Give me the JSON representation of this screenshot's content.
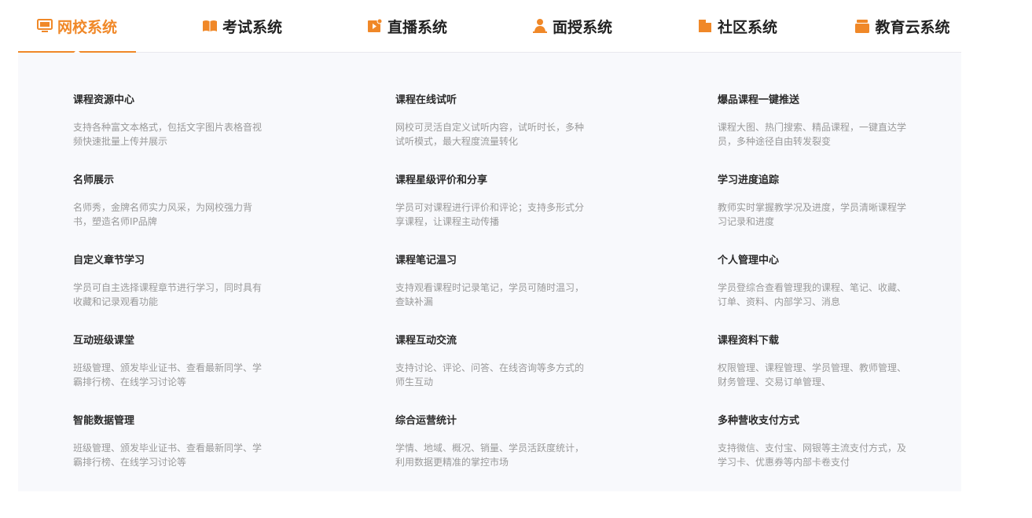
{
  "tabs": [
    {
      "label": "网校系统",
      "icon": "monitor-icon",
      "active": true
    },
    {
      "label": "考试系统",
      "icon": "book-icon",
      "active": false
    },
    {
      "label": "直播系统",
      "icon": "live-play-icon",
      "active": false
    },
    {
      "label": "面授系统",
      "icon": "teacher-icon",
      "active": false
    },
    {
      "label": "社区系统",
      "icon": "community-icon",
      "active": false
    },
    {
      "label": "教育云系统",
      "icon": "cloud-box-icon",
      "active": false
    }
  ],
  "colors": {
    "accent": "#f08828",
    "panel_bg": "#f8f9fc"
  },
  "features": [
    {
      "title": "课程资源中心",
      "desc": "支持各种富文本格式，包括文字图片表格音视频快速批量上传并展示"
    },
    {
      "title": "课程在线试听",
      "desc": "网校可灵活自定义试听内容，试听时长，多种试听模式，最大程度流量转化"
    },
    {
      "title": "爆品课程一键推送",
      "desc": "课程大图、热门搜索、精品课程，一键直达学员，多种途径自由转发裂变"
    },
    {
      "title": "名师展示",
      "desc": "名师秀，金牌名师实力风采，为网校强力背书，塑造名师IP品牌"
    },
    {
      "title": "课程星级评价和分享",
      "desc": "学员可对课程进行评价和评论；支持多形式分享课程，让课程主动传播"
    },
    {
      "title": "学习进度追踪",
      "desc": "教师实时掌握教学况及进度，学员清晰课程学习记录和进度"
    },
    {
      "title": "自定义章节学习",
      "desc": "学员可自主选择课程章节进行学习，同时具有收藏和记录观看功能"
    },
    {
      "title": "课程笔记温习",
      "desc": "支持观看课程时记录笔记，学员可随时温习，查缺补漏"
    },
    {
      "title": "个人管理中心",
      "desc": "学员登综合查看管理我的课程、笔记、收藏、订单、资料、内部学习、消息"
    },
    {
      "title": "互动班级课堂",
      "desc": "班级管理、颁发毕业证书、查看最新同学、学霸排行榜、在线学习讨论等"
    },
    {
      "title": "课程互动交流",
      "desc": "支持讨论、评论、问答、在线咨询等多方式的师生互动"
    },
    {
      "title": "课程资料下载",
      "desc": "权限管理、课程管理、学员管理、教师管理、财务管理、交易订单管理、"
    },
    {
      "title": "智能数据管理",
      "desc": "班级管理、颁发毕业证书、查看最新同学、学霸排行榜、在线学习讨论等"
    },
    {
      "title": "综合运营统计",
      "desc": "学情、地域、概况、销量、学员活跃度统计，利用数据更精准的掌控市场"
    },
    {
      "title": "多种营收支付方式",
      "desc": "支持微信、支付宝、网银等主流支付方式，及学习卡、优惠券等内部卡卷支付"
    }
  ]
}
